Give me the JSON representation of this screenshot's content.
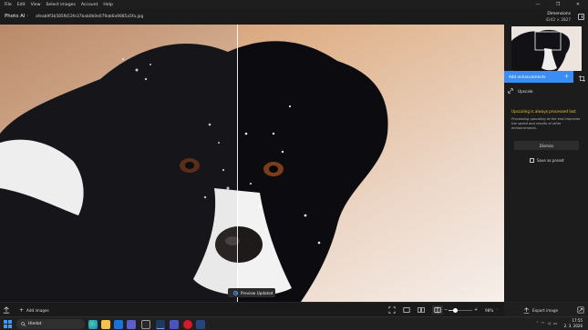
{
  "menu": {
    "items": [
      "File",
      "Edit",
      "View",
      "Select images",
      "Account",
      "Help"
    ]
  },
  "window_controls": {
    "minimize": "—",
    "maximize": "❐",
    "close": "✕"
  },
  "header": {
    "app_name": "Photo AI",
    "app_chevron": "˅",
    "filename": "afeab9f3b585fb53fe37bab0b0e079ab6a9885a5fa.jpg",
    "dimensions_label": "Dimensions",
    "dimensions_value": "4242 × 2827"
  },
  "viewer": {
    "compare_split_fraction": 0.472,
    "toast_text": "Preview Updated",
    "icons": {
      "toast": "checkmark-spinner-icon"
    }
  },
  "sidebar": {
    "add_enhancements_label": "Add enhancements",
    "add_enhancements_plus": "+",
    "upscale_label": "Upscale",
    "notice_heading": "Upscaling is always processed last",
    "notice_body": "Processing upscaling at the end improves the speed and results of other enhancements.",
    "dismiss_label": "Dismiss",
    "save_preset_label": "Save as preset",
    "icons": {
      "crop": "crop-icon",
      "upscale": "upscale-icon",
      "preset": "preset-icon"
    }
  },
  "bottombar": {
    "add_images_label": "Add images",
    "zoom_value": "98%",
    "zoom_fraction": 0.3,
    "export_label": "Export image",
    "icons": {
      "import": "import-icon",
      "fit": "fit-screen-icon",
      "single_view": "single-view-icon",
      "side_by_side": "side-by-side-icon",
      "split_view": "split-view-icon",
      "zoom_out": "zoom-out-icon",
      "zoom_in": "zoom-in-icon",
      "zoom_menu": "chevron-down-icon",
      "export": "export-icon",
      "export_settings": "export-settings-icon"
    }
  },
  "taskbar": {
    "search_text": "Hledat",
    "time": "17:55",
    "date": "2. 3. 2026",
    "tray_chevron": "˄",
    "tray_icons": [
      "wifi-icon",
      "volume-icon",
      "battery-icon"
    ],
    "apps": [
      "edge-icon",
      "file-explorer-icon",
      "mail-icon",
      "teams-icon",
      "store-icon",
      "photo-ai-icon",
      "teams-chat-icon",
      "opera-icon",
      "app-icon"
    ]
  },
  "colors": {
    "accent": "#3a8df3",
    "notice_heading": "#f1c232",
    "background": "#1b1b1b"
  }
}
